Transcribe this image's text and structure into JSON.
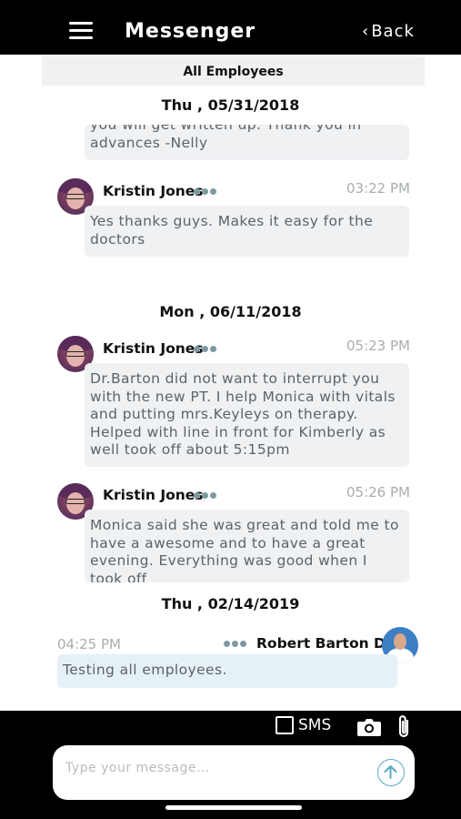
{
  "header": {
    "title": "Messenger",
    "back_label": "Back"
  },
  "channel": {
    "name": "All Employees"
  },
  "dates": [
    "Thu , 05/31/2018",
    "Mon , 06/11/2018",
    "Thu , 02/14/2019"
  ],
  "messages": [
    {
      "text": "you will get written up. Thank you in advances -Nelly"
    },
    {
      "sender": "Kristin Jones",
      "time": "03:22 PM",
      "text": "Yes thanks guys. Makes it easy for the doctors"
    },
    {
      "sender": "Kristin Jones",
      "time": "05:23 PM",
      "text": "Dr.Barton did not want to interrupt you with the new PT. I help Monica with vitals and putting mrs.Keyleys on therapy. Helped with line in front for Kimberly as well took off about 5:15pm"
    },
    {
      "sender": "Kristin Jones",
      "time": "05:26 PM",
      "text": "Monica said she was great and told me to have a awesome and to have a great evening. Everything was good when I took off"
    },
    {
      "sender": "Robert Barton DC",
      "time": "04:25 PM",
      "text": "Testing all employees."
    }
  ],
  "composer": {
    "placeholder": "Type your message...",
    "sms_label": "SMS"
  },
  "icons": {
    "menu": "hamburger-icon",
    "back": "chevron-left-icon",
    "options": "more-dots-icon",
    "camera": "camera-icon",
    "attach": "paperclip-icon",
    "send": "send-arrow-icon"
  },
  "colors": {
    "bar": "#000000",
    "bubble": "#eff1f3",
    "own_bubble": "#e6f1f7",
    "send_accent": "#5aa9c8"
  }
}
